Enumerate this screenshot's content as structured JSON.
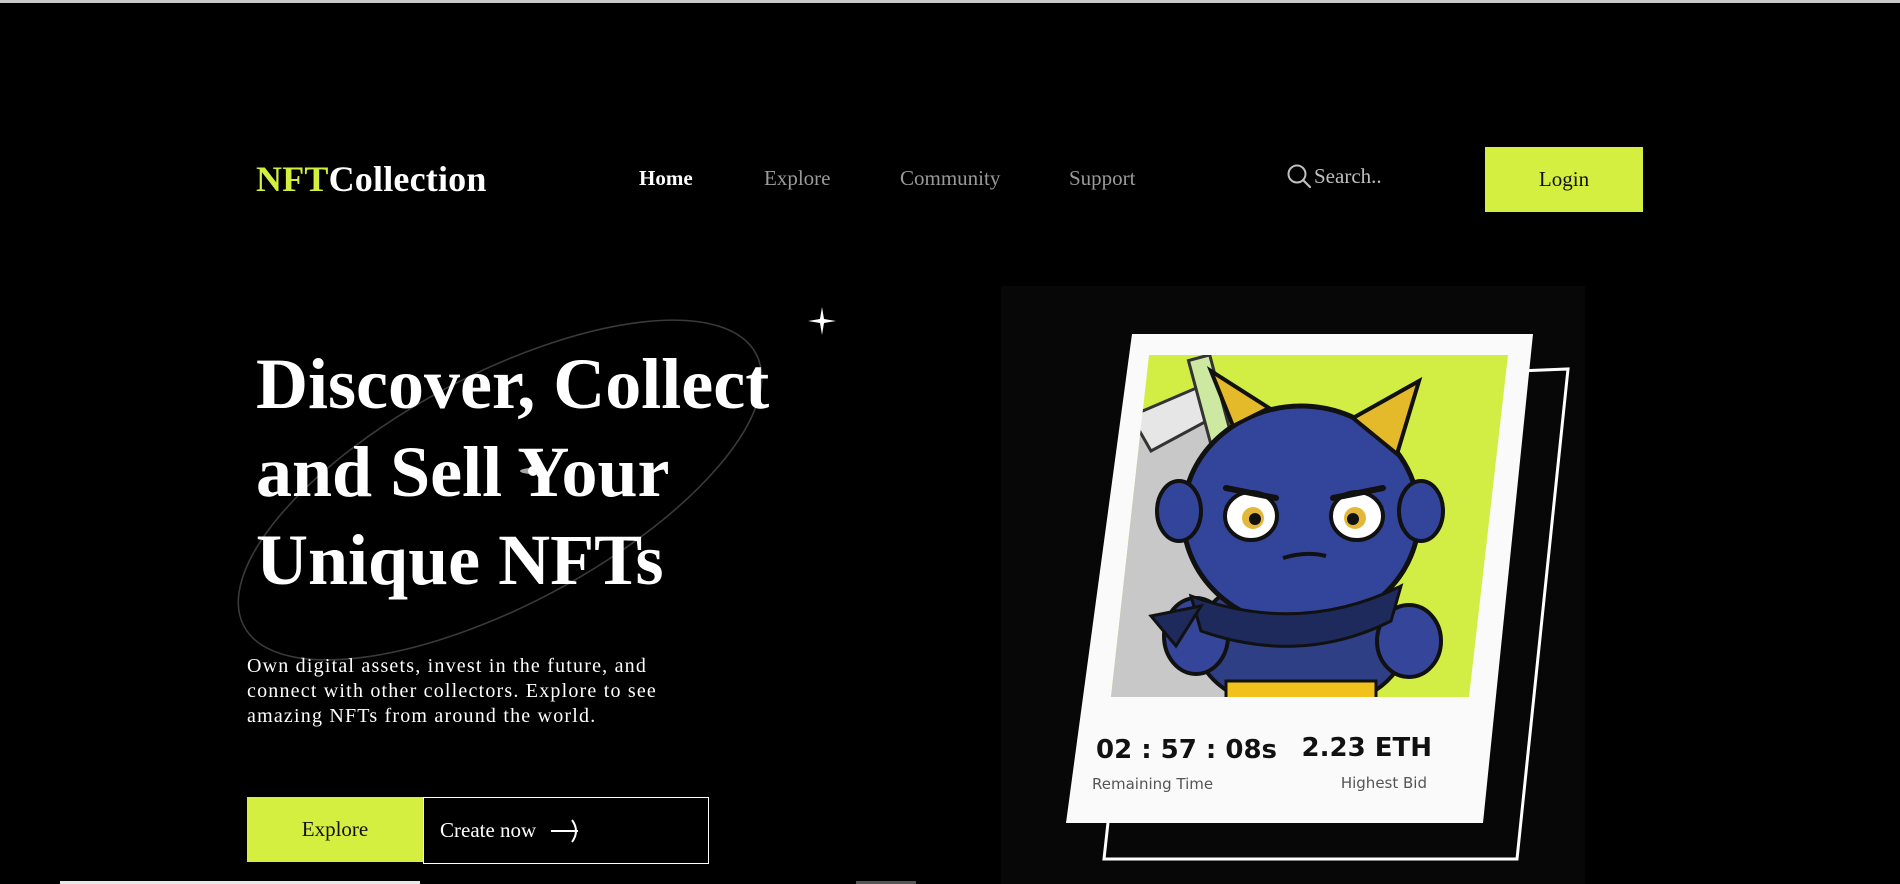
{
  "header": {
    "logo_accent": "NFT",
    "logo_rest": "Collection",
    "nav": [
      "Home",
      "Explore",
      "Community",
      "Support"
    ],
    "search_placeholder": "Search..",
    "login_label": "Login"
  },
  "hero": {
    "title_lines": [
      "Discover, Collect",
      "and Sell Your",
      "Unique NFTs"
    ],
    "description_lines": [
      "Own digital assets, invest in the future, and",
      "connect with other collectors. Explore to see",
      "amazing NFTs from around the world."
    ],
    "explore_label": "Explore",
    "create_label": "Create now"
  },
  "card": {
    "remaining_time": "02 : 57 : 08s",
    "remaining_label": "Remaining Time",
    "highest_bid": "2.23 ETH",
    "highest_label": "Highest Bid"
  },
  "colors": {
    "accent": "#d4ef3f",
    "background": "#000000",
    "nav_inactive": "#9a9a9a"
  },
  "icons": {
    "search": "search-icon",
    "arrow": "arrow-right-icon",
    "sparkle": "sparkle-icon"
  }
}
